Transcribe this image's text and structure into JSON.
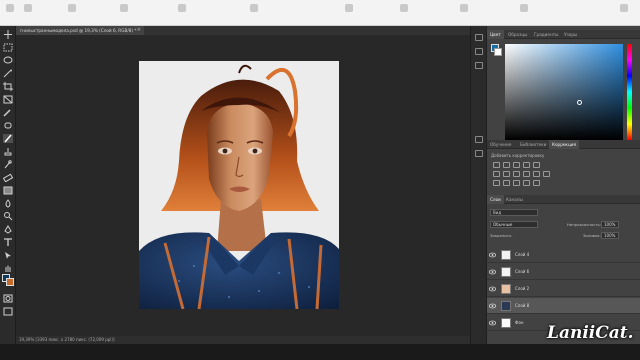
{
  "document": {
    "tab_title": "гнилыстраннымодела.psd @ 19,3% (Слой 6, RGB/8) *",
    "status": "19,39%   [3393 пикс. x 2780 пикс. (72,009 ppi)]"
  },
  "color_panel": {
    "tabs": [
      "Цвет",
      "Образцы",
      "Градиенты",
      "Узоры"
    ],
    "active_tab": "Цвет",
    "foreground": "#1a6fa8",
    "background": "#ffffff"
  },
  "adjustments_panel": {
    "tabs": [
      "Обучение",
      "Библиотеки",
      "Коррекция"
    ],
    "active_tab": "Коррекция",
    "hint": "Добавить корректировку"
  },
  "layers_panel": {
    "tabs": [
      "Слои",
      "Каналы"
    ],
    "active_tab": "Слои",
    "filter": "Вид",
    "blend_mode": "Обычные",
    "opacity_label": "Непрозрачность:",
    "opacity_value": "100%",
    "lock_label": "Закрепить:",
    "fill_label": "Заливка:",
    "fill_value": "100%",
    "layers": [
      {
        "name": "Слой 4",
        "selected": false
      },
      {
        "name": "Слой 6",
        "selected": false
      },
      {
        "name": "Слой 2",
        "selected": false
      },
      {
        "name": "Слой 8",
        "selected": true
      },
      {
        "name": "Фон",
        "selected": false
      }
    ]
  },
  "watermark": "LaniiCat.",
  "colors": {
    "ui_dark": "#323232",
    "panel": "#424242",
    "accent_blue": "#2f8fe0",
    "skin": "#d79a70",
    "hair": "#b8541f",
    "shirt": "#1d3a66"
  }
}
